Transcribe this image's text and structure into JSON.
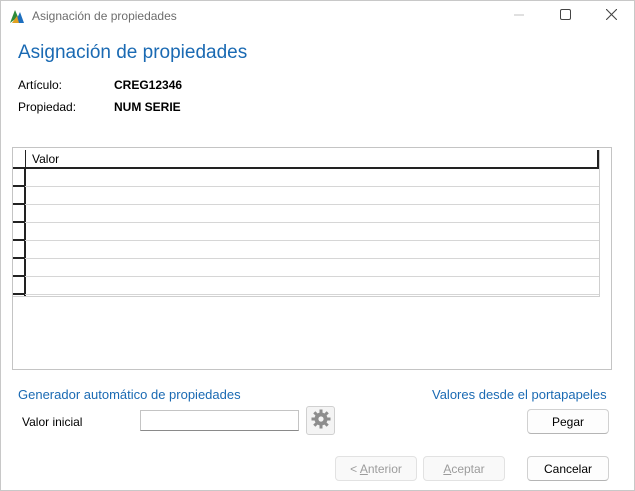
{
  "window": {
    "title": "Asignación de propiedades",
    "icons": {
      "app": "app-logo-icon",
      "minimize": "minimize-icon",
      "maximize": "maximize-icon",
      "close": "close-icon"
    }
  },
  "header": {
    "heading": "Asignación de propiedades",
    "articulo_label": "Artículo:",
    "articulo_value": "CREG12346",
    "propiedad_label": "Propiedad:",
    "propiedad_value": "NUM SERIE"
  },
  "grid": {
    "columns": [
      "Valor"
    ],
    "rows": [
      "",
      "",
      "",
      "",
      "",
      "",
      ""
    ]
  },
  "generator": {
    "title": "Generador automático de propiedades",
    "valor_inicial_label": "Valor inicial",
    "valor_inicial_value": "",
    "generate_icon": "gear-icon"
  },
  "clipboard": {
    "title": "Valores desde el portapapeles",
    "paste_label": "Pegar"
  },
  "footer": {
    "anterior_prefix": "< ",
    "anterior_mnemonic": "A",
    "anterior_rest": "nterior",
    "aceptar_mnemonic": "A",
    "aceptar_rest": "ceptar",
    "cancelar_label": "Cancelar"
  },
  "colors": {
    "accent": "#1a6ab3",
    "disabled_text": "#9c9c9c"
  }
}
